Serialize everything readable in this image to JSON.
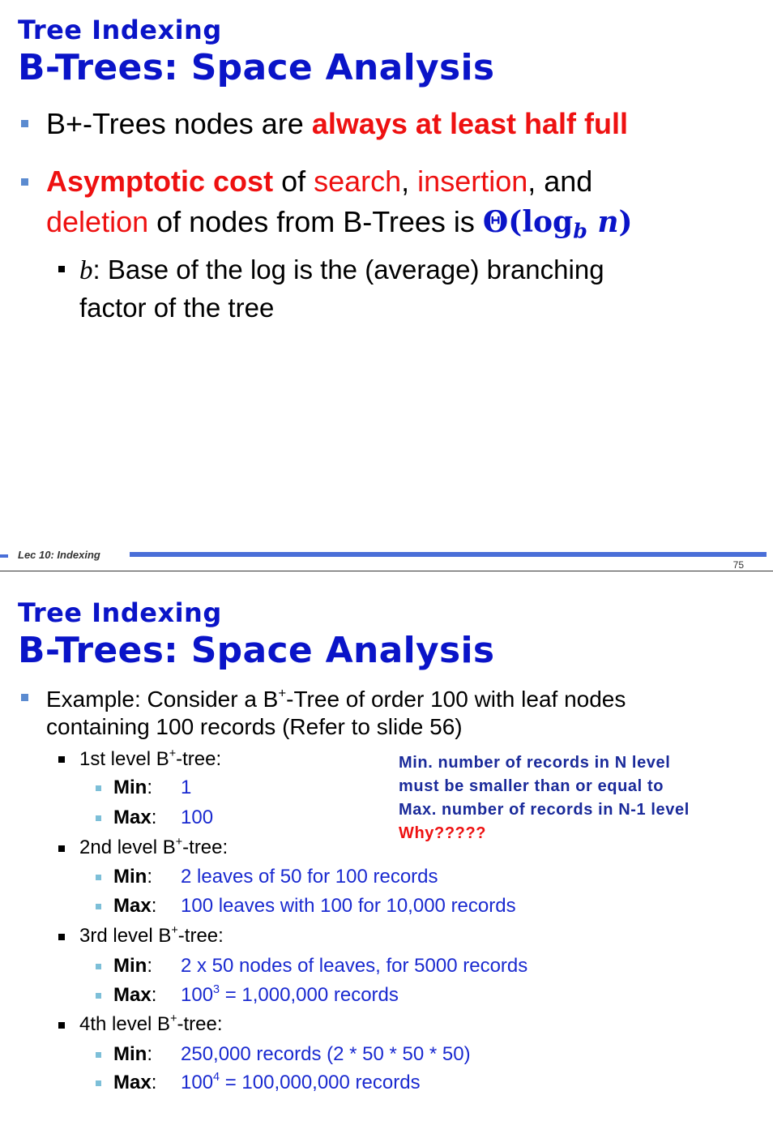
{
  "slide1": {
    "subtitle": "Tree Indexing",
    "title": "B-Trees: Space Analysis",
    "b1": {
      "t1": "B+-Trees nodes are ",
      "t2": "always at least half full"
    },
    "b2": {
      "t1": "Asymptotic cost",
      "t2": " of ",
      "t3": "search",
      "t4": ", ",
      "t5": "insertion",
      "t6": ", and",
      "t7": "deletion",
      "t8": " of nodes from B-Trees is ",
      "m1": "Θ(log",
      "m2": "b",
      "m3": " n",
      "m4": ")"
    },
    "b3": {
      "var": "b",
      "t1": ": Base of the log is the (average) branching",
      "t2": "factor of the tree"
    },
    "footer": "Lec 10: Indexing",
    "page": "75"
  },
  "slide2": {
    "subtitle": "Tree Indexing",
    "title": "B-Trees: Space Analysis",
    "example": {
      "l1a": "Example: Consider a B",
      "l1sup": "+",
      "l1b": "-Tree of order 100 with leaf nodes",
      "l2": "containing 100 records (Refer to slide 56)"
    },
    "levels": [
      {
        "label": "1st level B",
        "sup": "+",
        "tail": "-tree:",
        "min_label": "Min",
        "min_val": "1",
        "max_label": "Max",
        "max_val": "100",
        "max_sup": "",
        "max_tail": ""
      },
      {
        "label": "2nd level B",
        "sup": "+",
        "tail": "-tree:",
        "min_label": "Min",
        "min_val": "2 leaves of 50 for 100 records",
        "max_label": "Max",
        "max_val": "100 leaves with 100 for 10,000 records",
        "max_sup": "",
        "max_tail": ""
      },
      {
        "label": "3rd level B",
        "sup": "+",
        "tail": "-tree:",
        "min_label": "Min",
        "min_val": "2 x 50 nodes of leaves, for 5000 records",
        "max_label": "Max",
        "max_val": "100",
        "max_sup": "3",
        "max_tail": " = 1,000,000 records"
      },
      {
        "label": "4th level B",
        "sup": "+",
        "tail": "-tree:",
        "min_label": "Min",
        "min_val": "250,000 records (2 * 50 * 50 * 50)",
        "max_label": "Max",
        "max_val": "100",
        "max_sup": "4",
        "max_tail": " = 100,000,000 records"
      }
    ],
    "note": {
      "l1": "Min. number of records in N level",
      "l2": "must be smaller than or equal to",
      "l3": "Max. number of records in N-1 level",
      "why": "Why?????"
    }
  }
}
